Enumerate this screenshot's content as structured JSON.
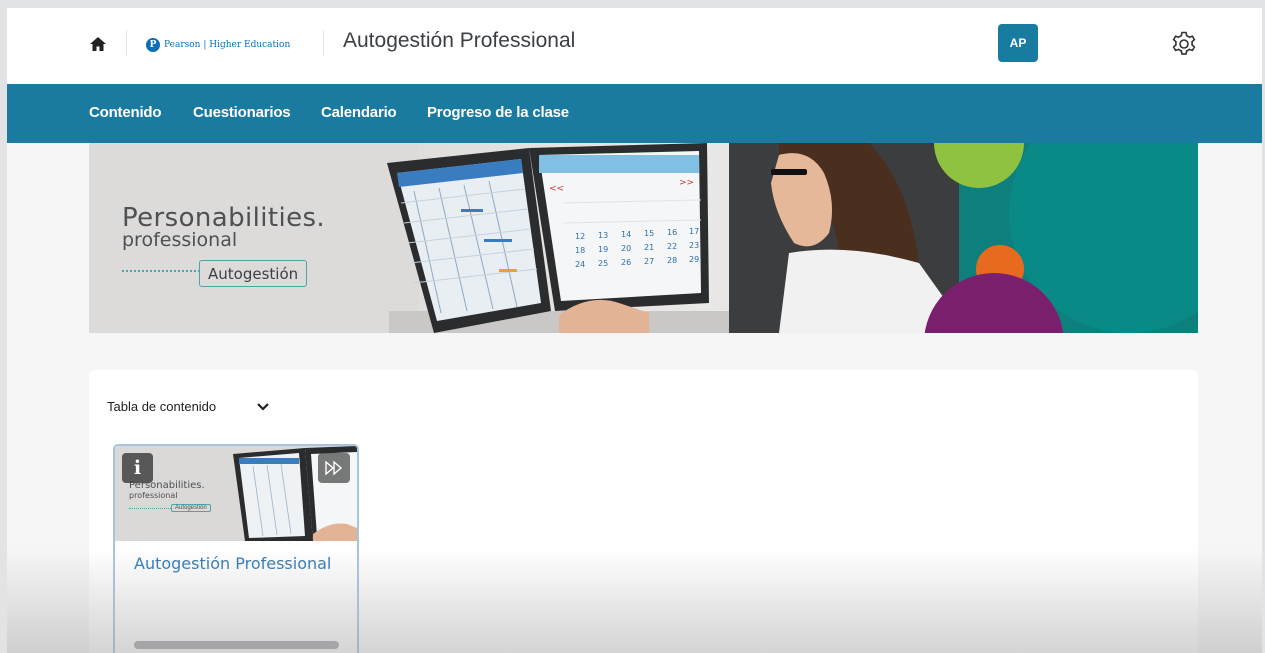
{
  "header": {
    "logo_mark": "P",
    "logo_text": "Pearson | Higher Education",
    "course_title": "Autogestión Professional",
    "avatar_initials": "AP"
  },
  "nav": {
    "items": [
      {
        "label": "Contenido"
      },
      {
        "label": "Cuestionarios"
      },
      {
        "label": "Calendario"
      },
      {
        "label": "Progreso de la clase"
      }
    ]
  },
  "banner": {
    "brand_title": "Personabilities.",
    "brand_subtitle": "professional",
    "brand_tag": "Autogestión",
    "calendar_numbers": [
      "12",
      "13",
      "14",
      "15",
      "16",
      "17",
      "18",
      "19",
      "20",
      "21",
      "22",
      "23",
      "24",
      "25",
      "26",
      "27",
      "28",
      "29"
    ]
  },
  "content": {
    "toc_label": "Tabla de contenido",
    "tile": {
      "title": "Autogestión Professional",
      "thumb_brand_title": "Personabilities.",
      "thumb_brand_subtitle": "professional",
      "thumb_brand_tag": "Autogestión",
      "info_glyph": "i"
    }
  },
  "colors": {
    "nav_bar": "#1b7aa0",
    "avatar": "#1a7ba1",
    "tile_title": "#2e78b7",
    "tile_border": "#a9c4df"
  },
  "icons": [
    "home-icon",
    "gear-icon",
    "chevron-down-icon",
    "info-icon",
    "play-forward-icon"
  ]
}
